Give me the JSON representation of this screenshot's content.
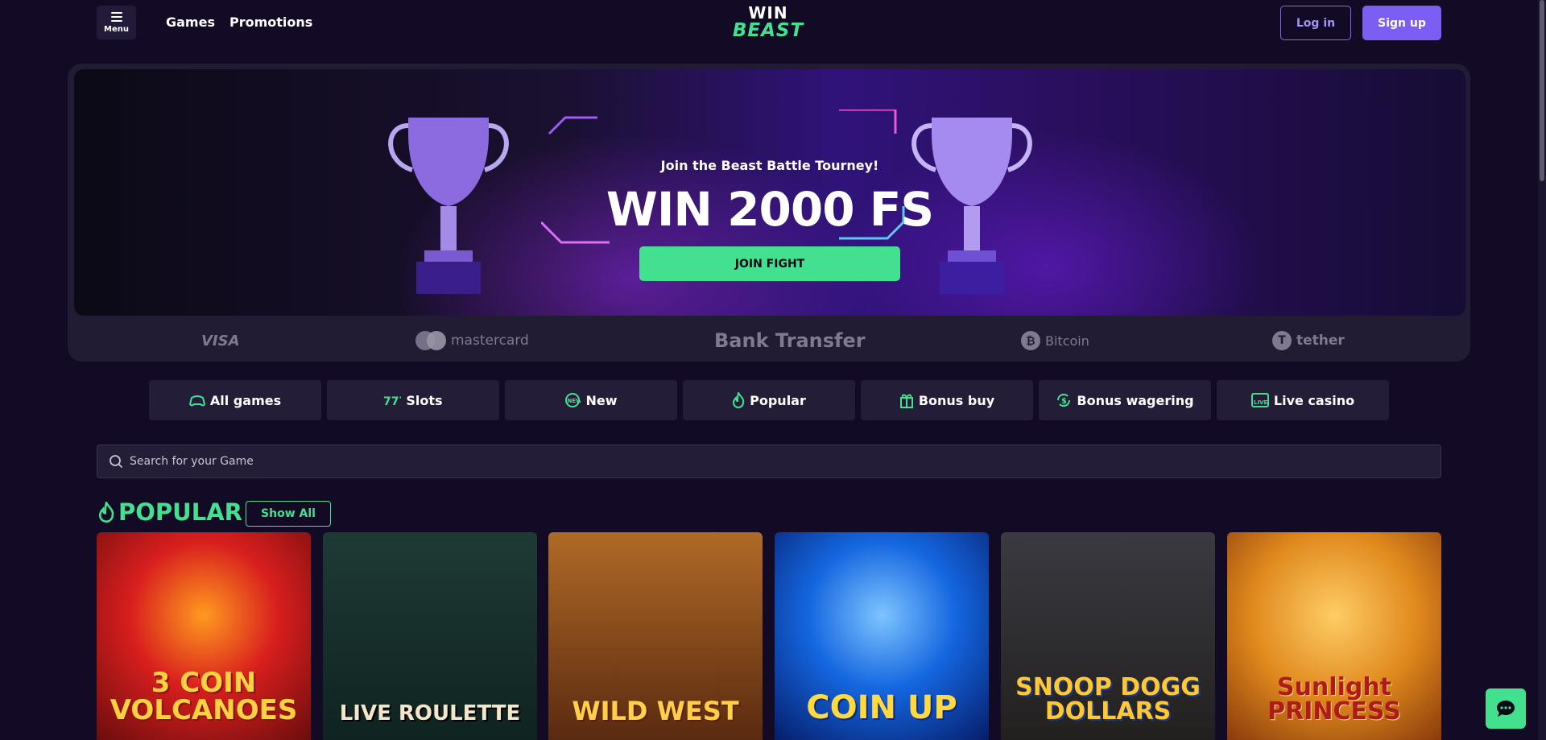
{
  "header": {
    "menu_label": "Menu",
    "nav": {
      "games": "Games",
      "promotions": "Promotions"
    },
    "logo": {
      "line1": "WIN",
      "line2": "BEAST"
    },
    "login": "Log in",
    "signup": "Sign up"
  },
  "hero": {
    "subtitle": "Join the Beast Battle Tourney!",
    "title": "WIN 2000 FS",
    "cta": "JOIN FIGHT"
  },
  "payments": {
    "visa": "VISA",
    "mastercard": "mastercard",
    "bank": "Bank Transfer",
    "bitcoin": "Bitcoin",
    "tether": "tether"
  },
  "categories": {
    "all": "All games",
    "slots": "Slots",
    "new": "New",
    "popular": "Popular",
    "bonus_buy": "Bonus buy",
    "bonus_wagering": "Bonus wagering",
    "live_casino": "Live casino"
  },
  "search": {
    "placeholder": "Search for your Game"
  },
  "popular": {
    "title": "POPULAR",
    "show_all": "Show All",
    "games": {
      "g1": "3 COIN VOLCANOES",
      "g2": "LIVE ROULETTE",
      "g3": "WILD WEST",
      "g4": "COIN UP",
      "g5": "SNOOP DOGG DOLLARS",
      "g6": "Sunlight PRINCESS"
    }
  },
  "colors": {
    "accent": "#43e08f",
    "brand": "#7d5ef5",
    "background": "#130b25",
    "surface": "#241d37"
  }
}
